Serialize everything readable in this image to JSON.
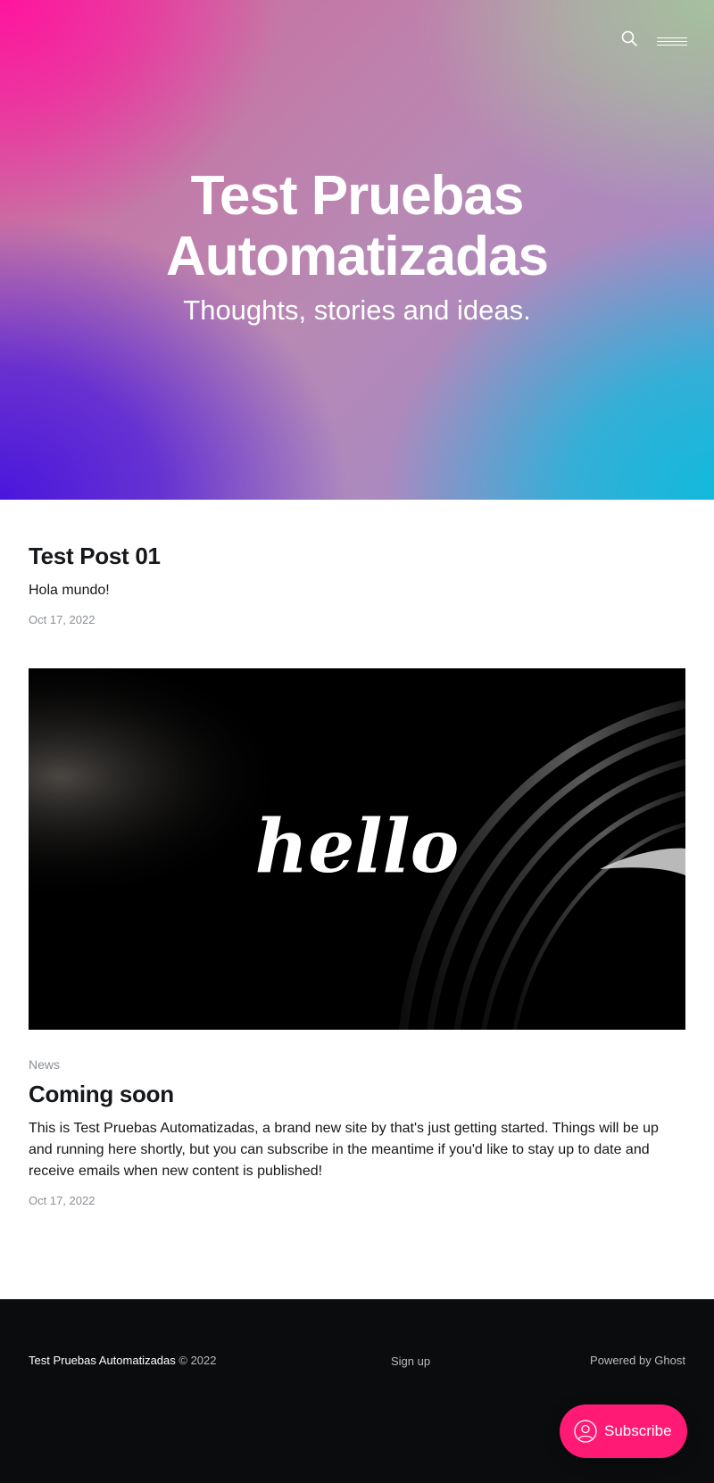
{
  "site": {
    "title": "Test Pruebas Automatizadas",
    "description": "Thoughts, stories and ideas.",
    "accent_color": "#ff1a75"
  },
  "nav": {
    "search_icon": "search-icon",
    "menu_icon": "menu-icon"
  },
  "posts": [
    {
      "title": "Test Post 01",
      "excerpt": "Hola mundo!",
      "date": "Oct 17, 2022"
    },
    {
      "image_text": "hello",
      "tag": "News",
      "title": "Coming soon",
      "excerpt": "This is Test Pruebas Automatizadas, a brand new site by   that's just getting started. Things will be up and running here shortly, but you can subscribe in the meantime if you'd like to stay up to date and receive emails when new content is published!",
      "date": "Oct 17, 2022"
    }
  ],
  "footer": {
    "site_title": "Test Pruebas Automatizadas",
    "copyright": "© 2022",
    "signup_label": "Sign up",
    "powered_by": "Powered by Ghost"
  },
  "portal": {
    "subscribe_label": "Subscribe",
    "icon": "user-icon"
  }
}
